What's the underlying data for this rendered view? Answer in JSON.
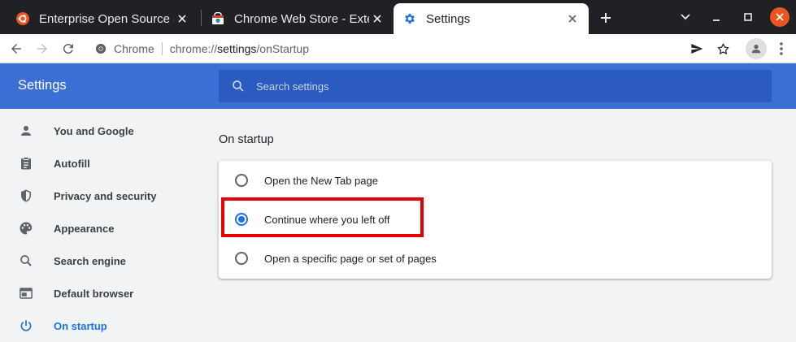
{
  "browser": {
    "tabs": [
      {
        "title": "Enterprise Open Source a",
        "icon": "ubuntu-icon",
        "active": false
      },
      {
        "title": "Chrome Web Store - Exter",
        "icon": "webstore-icon",
        "active": false
      },
      {
        "title": "Settings",
        "icon": "settings-gear-icon",
        "active": true
      }
    ],
    "address": {
      "origin_label": "Chrome",
      "url_scheme": "chrome://",
      "url_host": "settings",
      "url_path": "/onStartup"
    }
  },
  "settings": {
    "title": "Settings",
    "search_placeholder": "Search settings",
    "nav": [
      {
        "label": "You and Google",
        "icon": "person-icon"
      },
      {
        "label": "Autofill",
        "icon": "clipboard-icon"
      },
      {
        "label": "Privacy and security",
        "icon": "shield-icon"
      },
      {
        "label": "Appearance",
        "icon": "palette-icon"
      },
      {
        "label": "Search engine",
        "icon": "search-icon"
      },
      {
        "label": "Default browser",
        "icon": "browser-window-icon"
      },
      {
        "label": "On startup",
        "icon": "power-icon",
        "selected": true
      }
    ],
    "on_startup": {
      "title": "On startup",
      "options": [
        {
          "label": "Open the New Tab page",
          "checked": false
        },
        {
          "label": "Continue where you left off",
          "checked": true
        },
        {
          "label": "Open a specific page or set of pages",
          "checked": false
        }
      ]
    }
  },
  "colors": {
    "header_blue": "#3b6fd3",
    "accent_blue": "#1a73e8",
    "highlight_red": "#e80000",
    "tabstrip_dark": "#202124"
  }
}
